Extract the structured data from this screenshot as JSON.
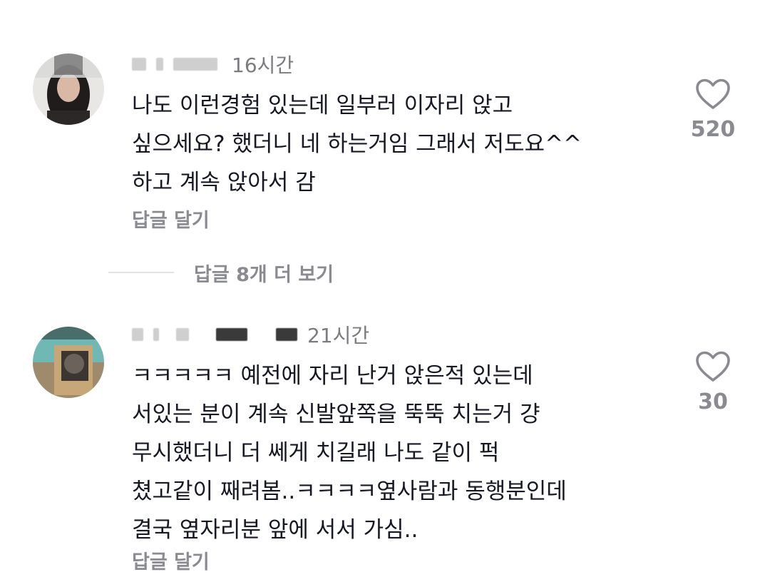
{
  "comments": [
    {
      "time": "16시간",
      "text": "나도 이런경험 있는데 일부러 이자리 앉고\n싶으세요? 했더니 네 하는거임 그래서 저도요^^\n하고 계속 앉아서 감",
      "reply_label": "답글 달기",
      "likes": "520",
      "like_icon": "heart-outline-icon"
    },
    {
      "time": "21시간",
      "text": "ㅋㅋㅋㅋㅋ 예전에 자리 난거 앉은적 있는데\n서있는 분이 계속 신발앞쪽을 뚝뚝 치는거 걍\n무시했더니 더 쎄게 치길래 나도 같이 퍽\n쳤고같이 째려봄..ㅋㅋㅋㅋ옆사람과 동행분인데\n결국 옆자리분 앞에 서서 가심..",
      "reply_label": "답글 달기",
      "likes": "30",
      "like_icon": "heart-outline-icon"
    }
  ],
  "view_more_replies": "답글 8개 더 보기",
  "colors": {
    "text": "#161823",
    "muted": "#8a8b91",
    "divider": "#e3e3e5"
  }
}
